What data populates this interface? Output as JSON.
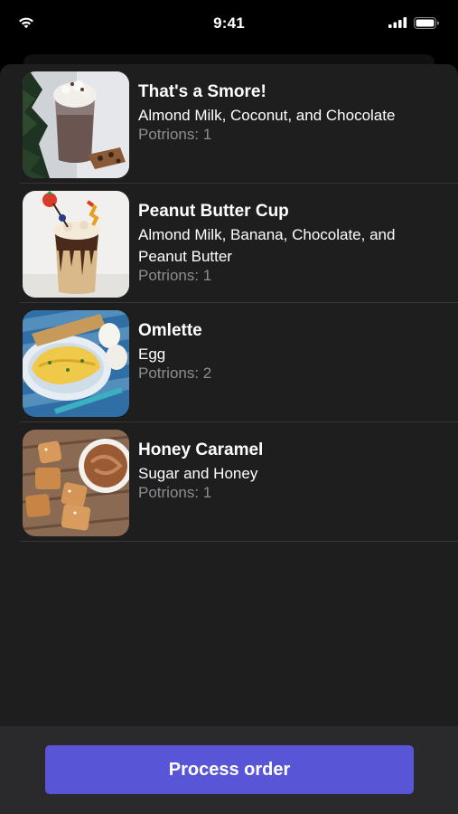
{
  "status_bar": {
    "time": "9:41",
    "icons": [
      "wifi-icon",
      "cellular-signal-icon",
      "battery-icon"
    ]
  },
  "orders": [
    {
      "title": "That's a Smore!",
      "ingredients": "Almond Milk, Coconut, and Chocolate",
      "portions": "Potrions: 1",
      "image": "smore-shake-photo"
    },
    {
      "title": "Peanut Butter Cup",
      "ingredients": "Almond Milk, Banana, Chocolate, and Peanut Butter",
      "portions": "Potrions: 1",
      "image": "peanut-butter-cup-shake-photo"
    },
    {
      "title": "Omlette",
      "ingredients": "Egg",
      "portions": "Potrions: 2",
      "image": "omelette-photo"
    },
    {
      "title": "Honey Caramel",
      "ingredients": "Sugar and Honey",
      "portions": "Potrions: 1",
      "image": "honey-caramel-photo"
    }
  ],
  "footer": {
    "process_label": "Process order"
  },
  "colors": {
    "accent": "#5856d6",
    "sheet_background": "#1e1e1f",
    "secondary_text": "#8d8d92"
  }
}
